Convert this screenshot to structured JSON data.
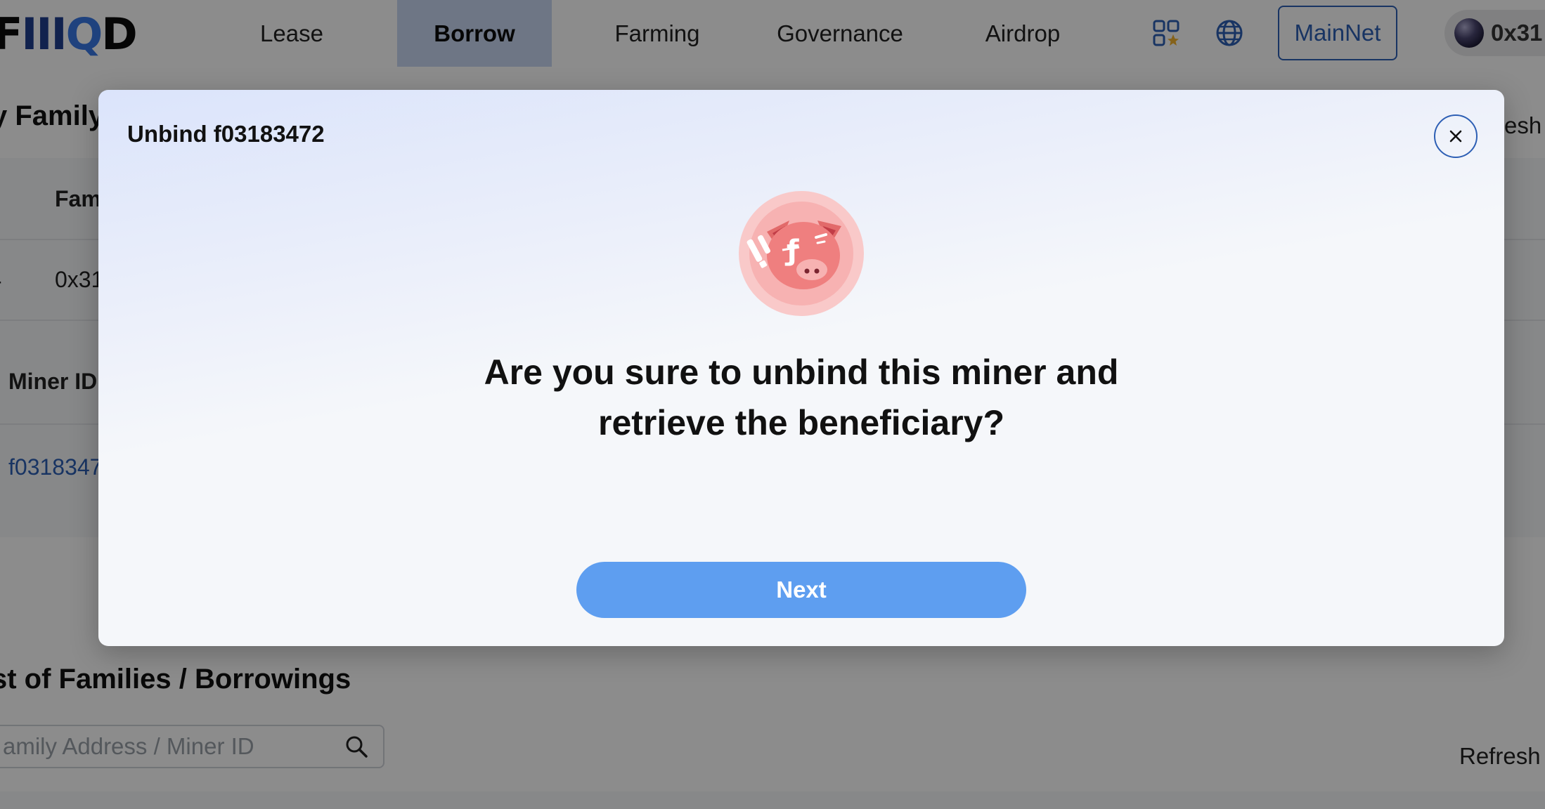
{
  "brand": {
    "logo_f": "F",
    "logo_bars": "III",
    "logo_q": "Q",
    "logo_d": "D"
  },
  "nav": {
    "items": [
      {
        "label": "Lease"
      },
      {
        "label": "Borrow",
        "active": true
      },
      {
        "label": "Farming"
      },
      {
        "label": "Governance"
      },
      {
        "label": "Airdrop"
      }
    ],
    "apps_icon": "apps-grid-icon",
    "globe_icon": "globe-icon",
    "network_label": "MainNet",
    "account_label": "0x31"
  },
  "background": {
    "family_title": "y Family",
    "refresh_top": "esh",
    "table": {
      "family_header": "Fam",
      "family_value": "0x31",
      "dash": "-",
      "miner_header": "Miner ID",
      "miner_value": "f0318347"
    },
    "list_title": "st of Families / Borrowings",
    "search_placeholder": "amily Address / Miner ID",
    "refresh_bottom": "Refresh"
  },
  "modal": {
    "title": "Unbind f03183472",
    "close_icon": "close-icon",
    "illustration": "pig-warning-illustration",
    "question_line1": "Are you sure to unbind this miner and",
    "question_line2": "retrieve the beneficiary?",
    "next_label": "Next"
  },
  "colors": {
    "accent": "#2d5fb4",
    "button": "#5e9ef0",
    "active_nav": "#c9d8f2"
  }
}
